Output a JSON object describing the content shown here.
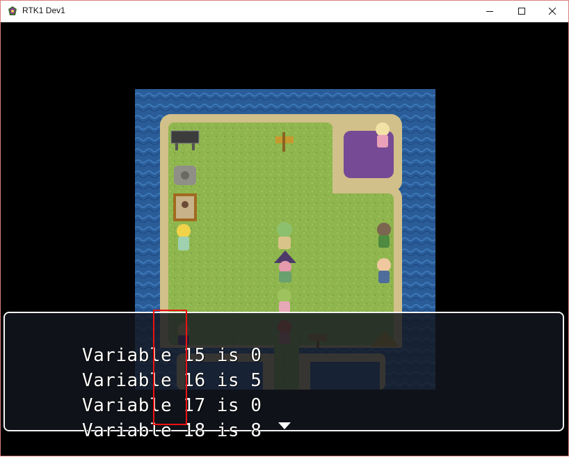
{
  "window": {
    "title": "RTK1 Dev1",
    "icons": {
      "app": "game-app-icon",
      "minimize": "minimize-icon",
      "maximize": "maximize-icon",
      "close": "close-icon"
    }
  },
  "message": {
    "lines": [
      {
        "label": "Variable 15 is ",
        "value": "0"
      },
      {
        "label": "Variable 16 is ",
        "value": "5"
      },
      {
        "label": "Variable 17 is ",
        "value": "0"
      },
      {
        "label": "Variable 18 is ",
        "value": "8"
      }
    ],
    "continue_icon": "down-triangle-icon"
  },
  "colors": {
    "water": "#2a5c98",
    "grass": "#8fb64e",
    "sand": "#d2c08a",
    "purple_zone": "#6b3d96",
    "highlight": "#ee1111"
  }
}
